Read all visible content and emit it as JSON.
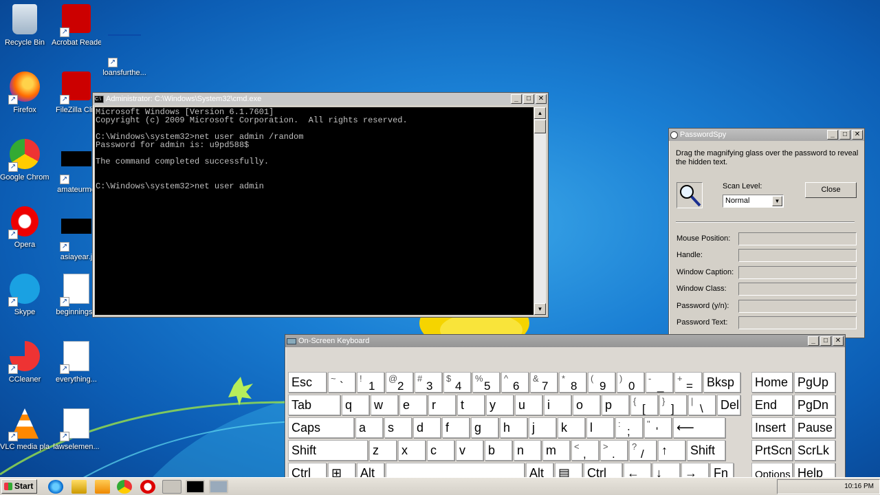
{
  "desktop": {
    "icons": [
      {
        "label": "Recycle Bin"
      },
      {
        "label": "Acrobat Reader DC"
      },
      {
        "label": "loansfurthe..."
      },
      {
        "label": "Firefox"
      },
      {
        "label": "FileZilla Clie"
      },
      {
        "label": "Google Chrome"
      },
      {
        "label": "amateurmo"
      },
      {
        "label": "Opera"
      },
      {
        "label": "asiayear.j"
      },
      {
        "label": "Skype"
      },
      {
        "label": "beginningse"
      },
      {
        "label": "CCleaner"
      },
      {
        "label": "everything..."
      },
      {
        "label": "VLC media player"
      },
      {
        "label": "lawselemen..."
      }
    ]
  },
  "cmd": {
    "title": "Administrator: C:\\Windows\\System32\\cmd.exe",
    "lines": [
      "Microsoft Windows [Version 6.1.7601]",
      "Copyright (c) 2009 Microsoft Corporation.  All rights reserved.",
      "",
      "C:\\Windows\\system32>net user admin /random",
      "Password for admin is: u9pd588$",
      "",
      "The command completed successfully.",
      "",
      "",
      "C:\\Windows\\system32>net user admin"
    ]
  },
  "passwordspy": {
    "title": "PasswordSpy",
    "description": "Drag the magnifying glass over the password to reveal the hidden text.",
    "scan_level_label": "Scan Level:",
    "scan_level_value": "Normal",
    "close_label": "Close",
    "fields": [
      {
        "label": "Mouse Position:",
        "value": ""
      },
      {
        "label": "Handle:",
        "value": ""
      },
      {
        "label": "Window Caption:",
        "value": ""
      },
      {
        "label": "Window Class:",
        "value": ""
      },
      {
        "label": "Password (y/n):",
        "value": ""
      },
      {
        "label": "Password Text:",
        "value": ""
      }
    ]
  },
  "osk": {
    "title": "On-Screen Keyboard",
    "rows": [
      [
        {
          "main": "Esc"
        },
        {
          "shift": "~",
          "main": "`"
        },
        {
          "shift": "!",
          "main": "1"
        },
        {
          "shift": "@",
          "main": "2"
        },
        {
          "shift": "#",
          "main": "3"
        },
        {
          "shift": "$",
          "main": "4"
        },
        {
          "shift": "%",
          "main": "5"
        },
        {
          "shift": "^",
          "main": "6"
        },
        {
          "shift": "&",
          "main": "7"
        },
        {
          "shift": "*",
          "main": "8"
        },
        {
          "shift": "(",
          "main": "9"
        },
        {
          "shift": ")",
          "main": "0"
        },
        {
          "shift": "-",
          "main": "_"
        },
        {
          "shift": "+",
          "main": "="
        },
        {
          "main": "Bksp"
        },
        {
          "main": "Home"
        },
        {
          "main": "PgUp"
        }
      ],
      [
        {
          "main": "Tab"
        },
        {
          "main": "q"
        },
        {
          "main": "w"
        },
        {
          "main": "e"
        },
        {
          "main": "r"
        },
        {
          "main": "t"
        },
        {
          "main": "y"
        },
        {
          "main": "u"
        },
        {
          "main": "i"
        },
        {
          "main": "o"
        },
        {
          "main": "p"
        },
        {
          "shift": "{",
          "main": "["
        },
        {
          "shift": "}",
          "main": "]"
        },
        {
          "shift": "|",
          "main": "\\"
        },
        {
          "main": "Del"
        },
        {
          "main": "End"
        },
        {
          "main": "PgDn"
        }
      ],
      [
        {
          "main": "Caps"
        },
        {
          "main": "a"
        },
        {
          "main": "s"
        },
        {
          "main": "d"
        },
        {
          "main": "f"
        },
        {
          "main": "g"
        },
        {
          "main": "h"
        },
        {
          "main": "j"
        },
        {
          "main": "k"
        },
        {
          "main": "l"
        },
        {
          "shift": ":",
          "main": ";"
        },
        {
          "shift": "\"",
          "main": "'"
        },
        {
          "main": "⟵"
        },
        {
          "main": "Insert"
        },
        {
          "main": "Pause"
        }
      ],
      [
        {
          "main": "Shift"
        },
        {
          "main": "z"
        },
        {
          "main": "x"
        },
        {
          "main": "c"
        },
        {
          "main": "v"
        },
        {
          "main": "b"
        },
        {
          "main": "n"
        },
        {
          "main": "m"
        },
        {
          "shift": "<",
          "main": ","
        },
        {
          "shift": ">",
          "main": "."
        },
        {
          "shift": "?",
          "main": "/"
        },
        {
          "main": "↑"
        },
        {
          "main": "Shift"
        },
        {
          "main": "PrtScn"
        },
        {
          "main": "ScrLk"
        }
      ],
      [
        {
          "main": "Ctrl"
        },
        {
          "main": "⊞"
        },
        {
          "main": "Alt"
        },
        {
          "main": ""
        },
        {
          "main": "Alt"
        },
        {
          "main": "▤"
        },
        {
          "main": "Ctrl"
        },
        {
          "main": "←"
        },
        {
          "main": "↓"
        },
        {
          "main": "→"
        },
        {
          "main": "Fn"
        },
        {
          "main": "Options"
        },
        {
          "main": "Help"
        }
      ]
    ]
  },
  "taskbar": {
    "start_label": "Start",
    "clock": "10:16 PM"
  },
  "colors": {
    "desktop_blue": "#1a7fd4",
    "window_face": "#d4d0c8",
    "cmd_text": "#c0c0c0"
  }
}
